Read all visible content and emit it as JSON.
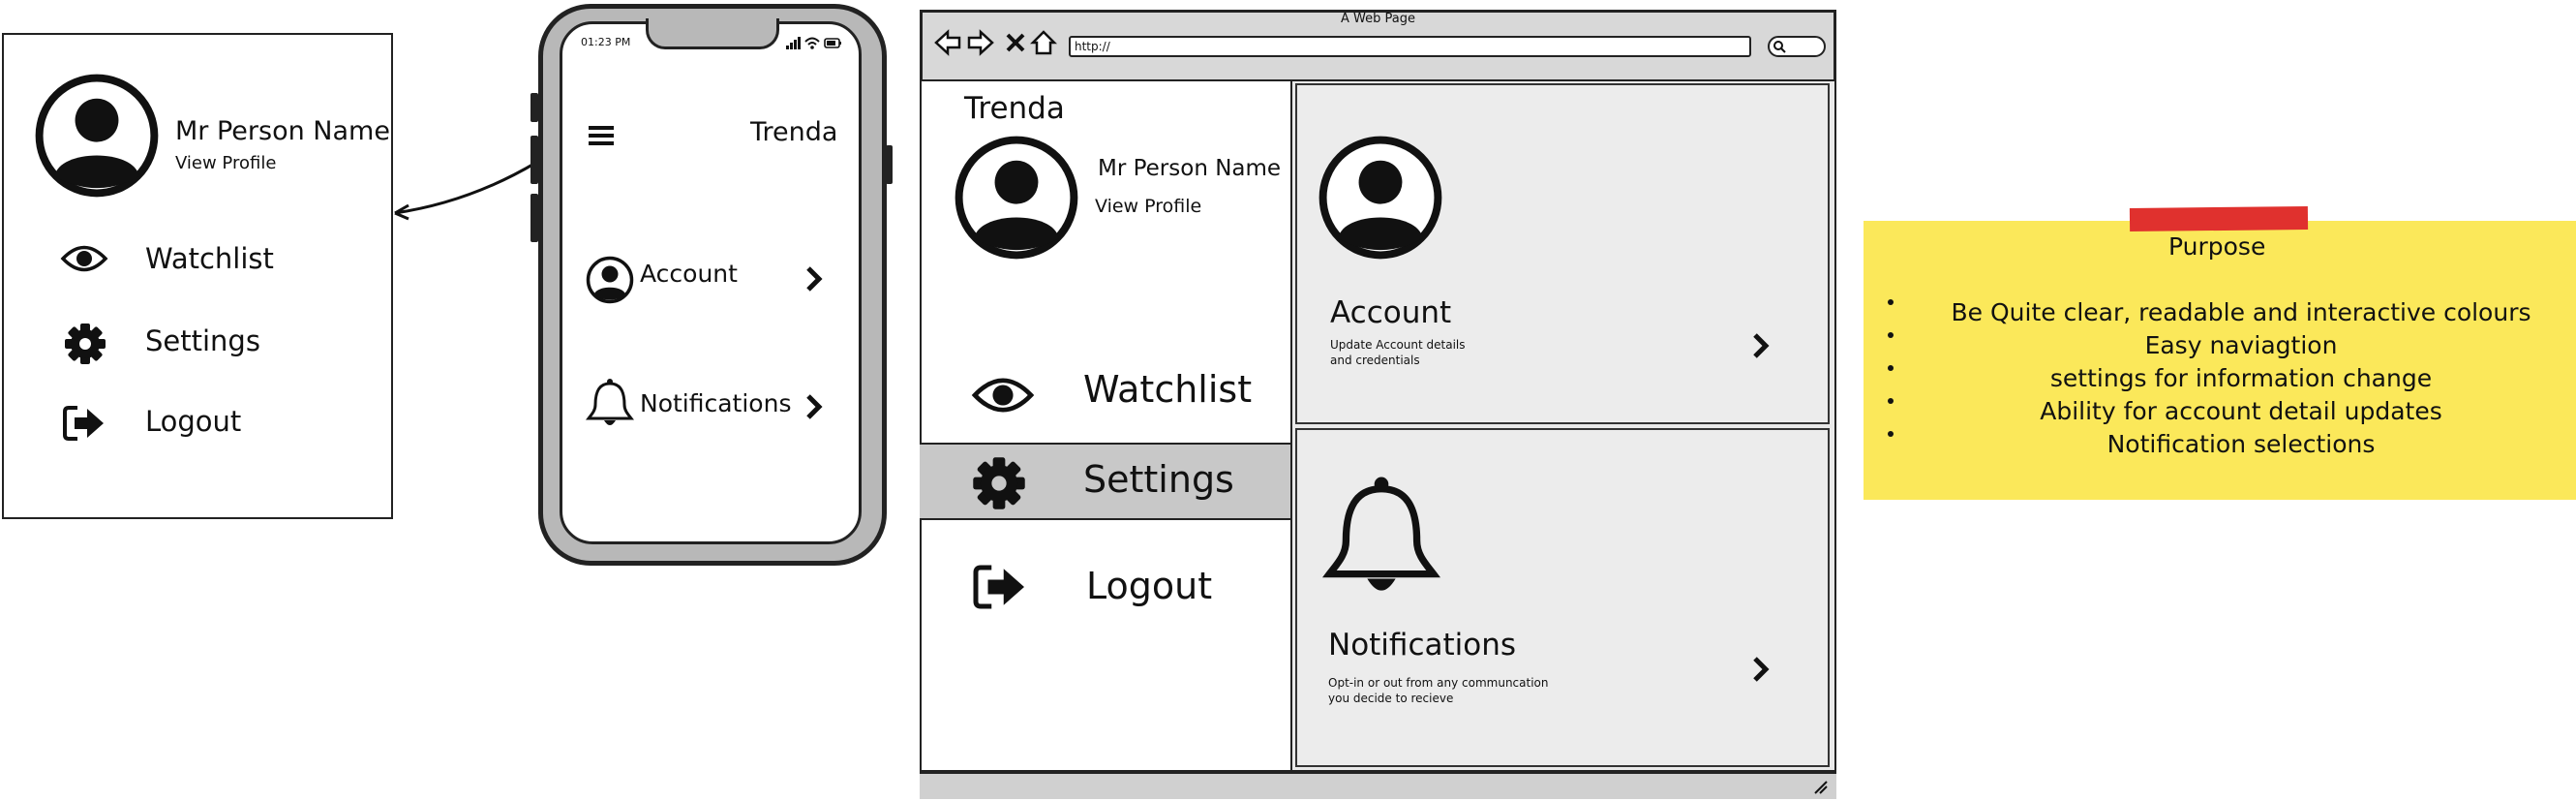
{
  "side_menu": {
    "user_name": "Mr Person Name",
    "view_profile": "View Profile",
    "items": [
      {
        "label": "Watchlist",
        "icon": "eye-icon"
      },
      {
        "label": "Settings",
        "icon": "gear-icon"
      },
      {
        "label": "Logout",
        "icon": "logout-icon"
      }
    ]
  },
  "phone": {
    "time": "01:23 PM",
    "app_title": "Trenda",
    "items": [
      {
        "label": "Account",
        "icon": "user-icon"
      },
      {
        "label": "Notifications",
        "icon": "bell-icon"
      }
    ]
  },
  "browser": {
    "window_title": "A Web Page",
    "url": "http://",
    "nav": {
      "brand": "Trenda",
      "user_name": "Mr Person Name",
      "view_profile": "View Profile",
      "items": [
        {
          "label": "Watchlist",
          "icon": "eye-icon",
          "selected": false
        },
        {
          "label": "Settings",
          "icon": "gear-icon",
          "selected": true
        },
        {
          "label": "Logout",
          "icon": "logout-icon",
          "selected": false
        }
      ]
    },
    "cards": [
      {
        "title": "Account",
        "desc_line1": "Update Account details",
        "desc_line2": "and credentials",
        "icon": "user-icon"
      },
      {
        "title": "Notifications",
        "desc_line1": "Opt-in or out from any communcation",
        "desc_line2": "you decide to recieve",
        "icon": "bell-icon"
      }
    ]
  },
  "note": {
    "title": "Purpose",
    "bullets": [
      "Be Quite clear, readable and interactive colours",
      "Easy naviagtion",
      "settings for information change",
      "Ability for account detail updates",
      "Notification selections"
    ]
  },
  "colors": {
    "note_yellow": "#fbe85a",
    "tape_red": "#e0312e",
    "selected_row": "#c8c8c8",
    "card_bg": "#ececec"
  }
}
